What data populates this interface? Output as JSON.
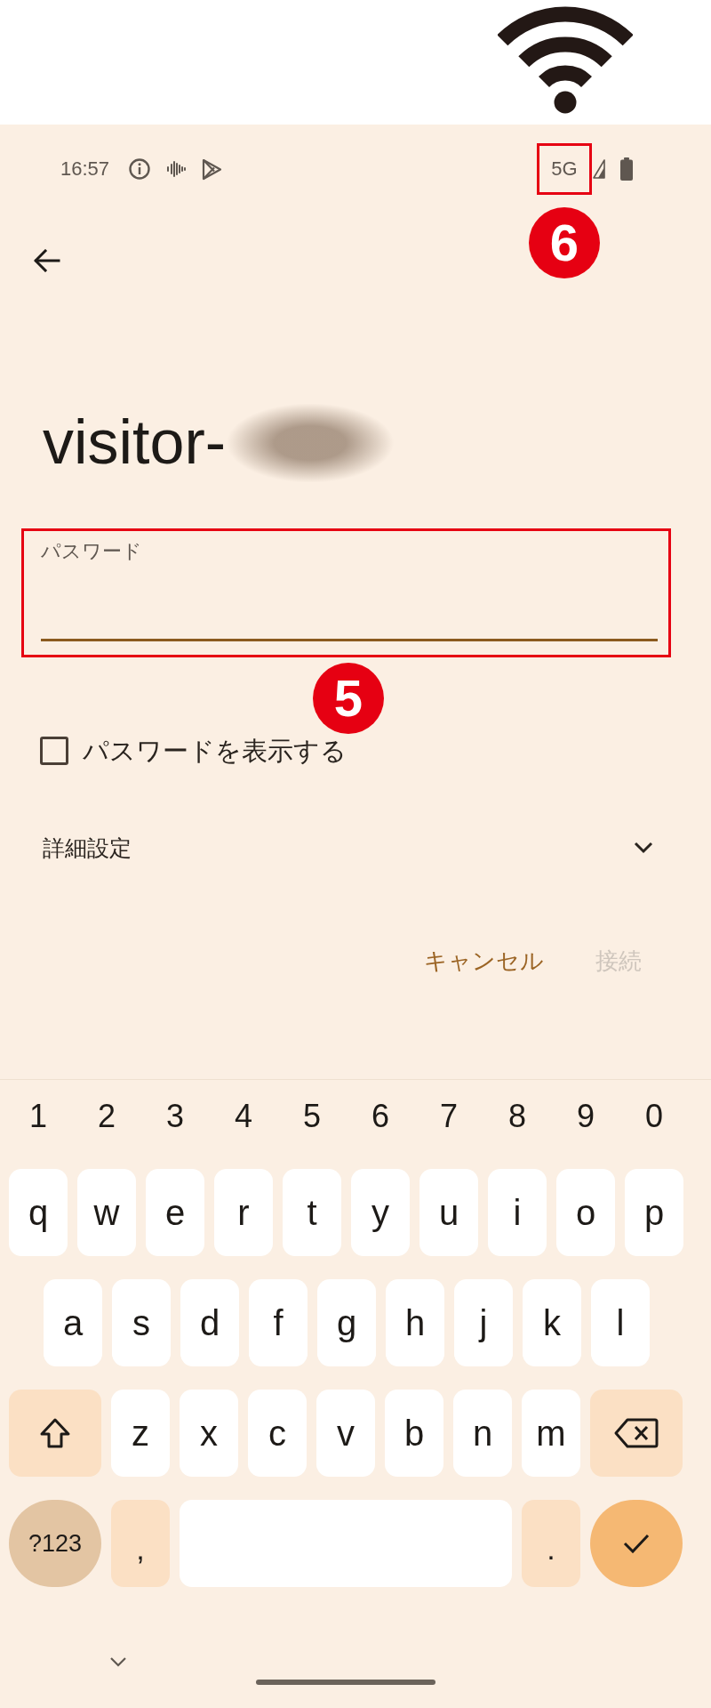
{
  "status_bar": {
    "time": "16:57",
    "network": "5G",
    "network_callout": "6"
  },
  "title": "visitor-",
  "password_field": {
    "label": "パスワード",
    "callout": "5"
  },
  "show_password": {
    "label": "パスワードを表示する",
    "checked": false
  },
  "advanced_settings": {
    "label": "詳細設定",
    "expanded": false
  },
  "actions": [
    {
      "label": "キャンセル",
      "disabled": false
    },
    {
      "label": "接続",
      "disabled": true
    }
  ],
  "keyboard": {
    "number_row": [
      "1",
      "2",
      "3",
      "4",
      "5",
      "6",
      "7",
      "8",
      "9",
      "0"
    ],
    "letter_rows": [
      [
        "q",
        "w",
        "e",
        "r",
        "t",
        "y",
        "u",
        "i",
        "o",
        "p"
      ],
      [
        "a",
        "s",
        "d",
        "f",
        "g",
        "h",
        "j",
        "k",
        "l"
      ],
      [
        "z",
        "x",
        "c",
        "v",
        "b",
        "n",
        "m"
      ]
    ],
    "bottom_row": [
      {
        "kind": "symbols",
        "label": "?123"
      },
      {
        "kind": "punctuation",
        "label": ","
      },
      {
        "kind": "space"
      },
      {
        "kind": "punctuation",
        "label": "."
      },
      {
        "kind": "enter"
      }
    ]
  }
}
